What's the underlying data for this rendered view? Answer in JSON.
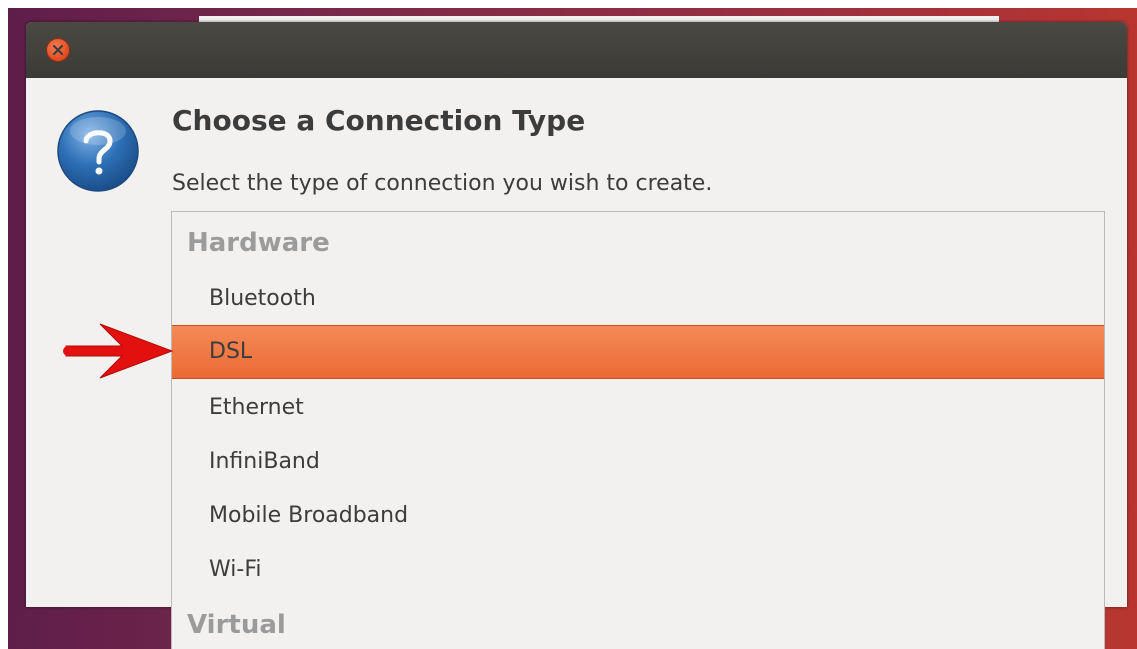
{
  "dialog": {
    "title": "Choose a Connection Type",
    "subtitle": "Select the type of connection you wish to create."
  },
  "icons": {
    "close": "close-icon",
    "question": "question-icon",
    "annotation_arrow": "arrow-right-icon"
  },
  "connection_list": {
    "groups": [
      {
        "header": "Hardware",
        "items": [
          "Bluetooth",
          "DSL",
          "Ethernet",
          "InfiniBand",
          "Mobile Broadband",
          "Wi-Fi"
        ]
      },
      {
        "header": "Virtual",
        "items": []
      }
    ],
    "selected_item": "DSL"
  },
  "colors": {
    "selection": "#ea6a35",
    "close_button": "#df4a1f",
    "annotation_arrow": "#e31010",
    "question_icon": "#2d6fb5"
  }
}
